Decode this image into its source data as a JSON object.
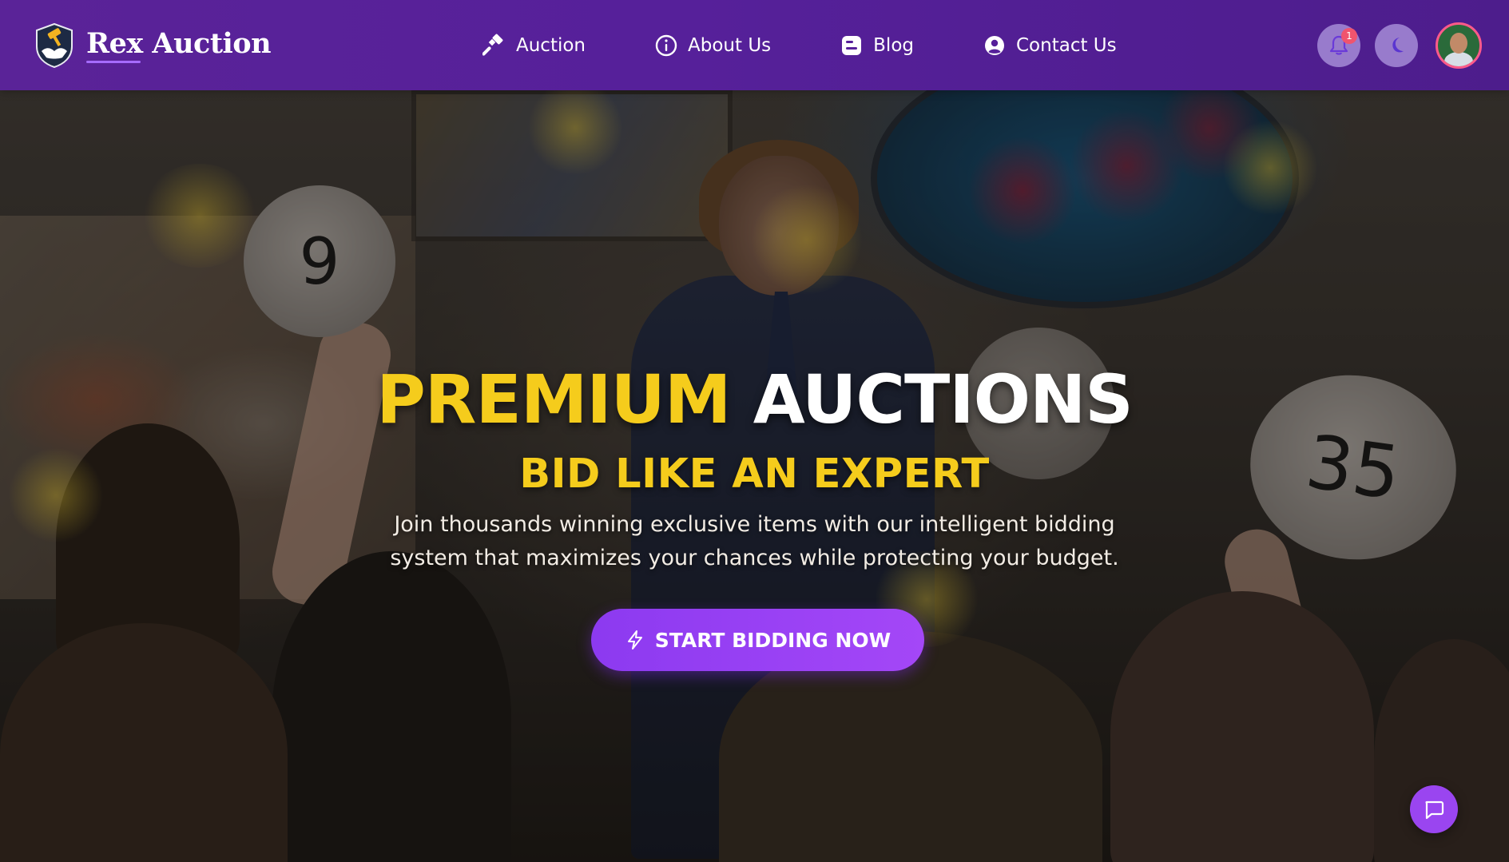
{
  "brand": {
    "name": "Rex Auction",
    "logo_icon": "gavel-handshake-shield-icon"
  },
  "nav": {
    "items": [
      {
        "label": "Auction",
        "icon": "gavel-icon"
      },
      {
        "label": "About Us",
        "icon": "info-circle-icon"
      },
      {
        "label": "Blog",
        "icon": "blog-icon"
      },
      {
        "label": "Contact Us",
        "icon": "user-circle-icon"
      }
    ]
  },
  "header_actions": {
    "notifications_icon": "bell-icon",
    "notification_count": "1",
    "theme_toggle_icon": "moon-icon",
    "avatar": "user-avatar"
  },
  "hero": {
    "title_highlight": "PREMIUM",
    "title_rest": "AUCTIONS",
    "subtitle": "BID LIKE AN EXPERT",
    "description": "Join thousands winning exclusive items with our intelligent bidding system that maximizes your chances while protecting your budget.",
    "cta_label": "START BIDDING NOW",
    "cta_icon": "lightning-bolt-icon",
    "paddle_left": "9",
    "paddle_right": "35"
  },
  "chat": {
    "icon": "chat-bubble-icon"
  },
  "colors": {
    "nav_bg": "#56209a",
    "accent_purple": "#9a45f0",
    "title_yellow": "#f5cc1c",
    "badge_red": "#f0546e"
  }
}
